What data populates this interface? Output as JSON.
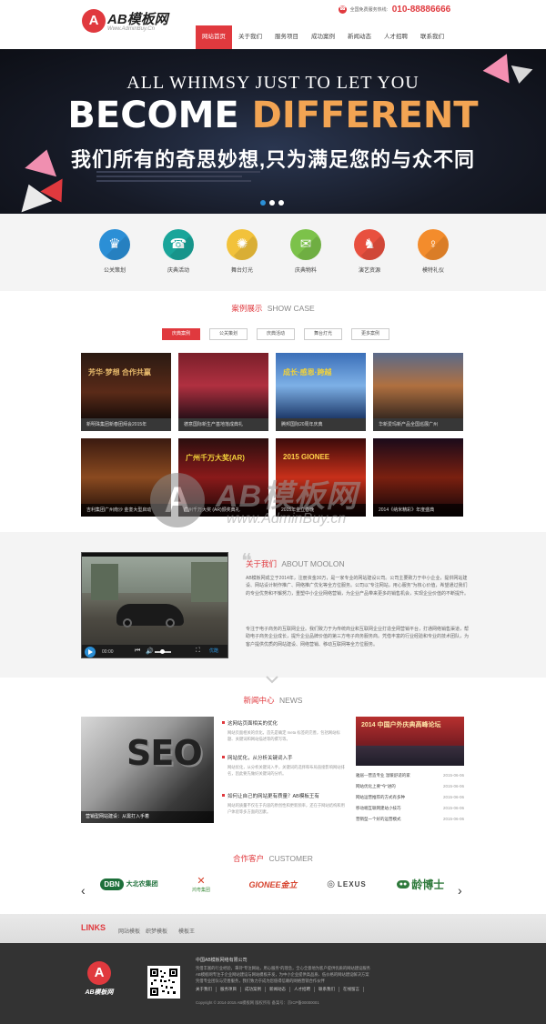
{
  "header": {
    "logo_mark": "A",
    "logo_text": "AB模板网",
    "logo_sub": "Www.AdminBuy.Cn",
    "hotline_label": "全国免费服务热线:",
    "hotline_number": "010-88886666"
  },
  "nav": {
    "items": [
      {
        "label": "网站首页",
        "active": true
      },
      {
        "label": "关于我们"
      },
      {
        "label": "服务项目"
      },
      {
        "label": "成功案例"
      },
      {
        "label": "新闻动态"
      },
      {
        "label": "人才招聘"
      },
      {
        "label": "联系我们"
      }
    ]
  },
  "banner": {
    "line1": "ALL WHIMSY JUST TO LET YOU",
    "big_word1": "BECOME",
    "big_word2": "DIFFERENT",
    "cn": "我们所有的奇思妙想,只为满足您的与众不同",
    "slides": 3,
    "active_slide": 1
  },
  "services": [
    {
      "label": "公关策划",
      "color": "#2b8fd6",
      "icon": "crown-icon",
      "glyph": "♛"
    },
    {
      "label": "庆典活动",
      "color": "#1aa59a",
      "icon": "phone-icon",
      "glyph": "☎"
    },
    {
      "label": "舞台灯光",
      "color": "#f2c23b",
      "icon": "stage-light-icon",
      "glyph": "✺"
    },
    {
      "label": "庆典物料",
      "color": "#7cc24a",
      "icon": "chat-icon",
      "glyph": "✉"
    },
    {
      "label": "演艺资源",
      "color": "#e8503f",
      "icon": "performers-icon",
      "glyph": "♞"
    },
    {
      "label": "模特礼仪",
      "color": "#f38c2c",
      "icon": "model-icon",
      "glyph": "♀"
    }
  ],
  "cases": {
    "title_cn": "案例展示",
    "title_en": "SHOW CASE",
    "tabs": [
      {
        "label": "庆典案例",
        "active": true
      },
      {
        "label": "公关策划"
      },
      {
        "label": "庆典活动"
      },
      {
        "label": "舞台灯光"
      },
      {
        "label": "更多案例"
      }
    ],
    "items": [
      {
        "caption": "新明珠集团新春团拜会2015年",
        "img_text": "芳华·梦想 合作共赢"
      },
      {
        "caption": "德意国际新生产基地落成典礼",
        "img_text": ""
      },
      {
        "caption": "腾邦国际20周年庆典",
        "img_text": "成长·感恩·跨越"
      },
      {
        "caption": "华新爱玛新产品全国巡展广州",
        "img_text": ""
      },
      {
        "caption": "吉利集团广州南沙 金銮大型启动",
        "img_text": ""
      },
      {
        "caption": "广州千万大奖 (AR)颁奖典礼",
        "img_text": "广州千万大奖(AR)"
      },
      {
        "caption": "2015年金立春晚",
        "img_text": "2015 GIONEE"
      },
      {
        "caption": "2014《纳米精彩》年度盛典",
        "img_text": ""
      }
    ]
  },
  "watermark": {
    "mark": "A",
    "text": "AB模板网",
    "url": "www.AdminBuy.cn"
  },
  "about": {
    "title_cn": "关于我们",
    "title_en": "ABOUT MOOLON",
    "p1": "AB模板网成立于2014年，注册资金30万，是一家专业的网站建设公司。公司主要致力于中小企业，提供网站建设、网站设计制作推广、网络推广优化等全方位服务。公司以\"专注网站，用心服务\"为核心价值，希望通过我们的专业优势和不懈努力，重塑中小企业网络营销，为企业产品带来更多的销售机会，实现企业价值的不断提升。",
    "p2": "专注于电子商务的互联网企业。我们致力于为传统商业和互联网企业打造全网营销平台，打通网络销售渠道，帮助电子商务企业成长，提升企业品牌价值的第三方电子商务服务商。凭借丰富的行业经验和专业的技术团队，为客户提供优质的网站建设、网络营销、移动互联网等全方位服务。",
    "video_time": "00:00",
    "video_brand": "优酷"
  },
  "news": {
    "title_cn": "新闻中心",
    "title_en": "NEWS",
    "big_caption": "营销型网站建设：从需打入手着",
    "seo_text": "SEO",
    "list": [
      {
        "title": "这网站页面相关的优化",
        "desc": "网站页面相关的优化，首先是确定 meta 标签的完善，包括网站标题、关键词和网站描述等的撰写等。"
      },
      {
        "title": "网站优化，从分析关键词入手",
        "desc": "网站优化，从分析关键词入手，关键词的选择和布局直接影响网站排名，因此要先做好关键词的分析。"
      },
      {
        "title": "如何让自己的网站更有质量？AB模板王有",
        "desc": "网站的质量不仅在于内容的原创性和更新频率，还在于网站结构和用户体验等多方面的因素。"
      }
    ],
    "right_img_text": "2014 中国户外庆典高峰论坛",
    "right_list": [
      {
        "title": "雅居—营造专业 温暖舒适的家",
        "date": "2015-06-06"
      },
      {
        "title": "网站优化上要\"今\"进的",
        "date": "2015-06-06"
      },
      {
        "title": "网站运营推荐的方式有多种",
        "date": "2015-06-06"
      },
      {
        "title": "移动端互联网建站小技巧",
        "date": "2015-06-06"
      },
      {
        "title": "营销型一个好的运营模式",
        "date": "2015-06-06"
      }
    ]
  },
  "partners": {
    "title_cn": "合作客户",
    "title_en": "CUSTOMER",
    "prev": "‹",
    "next": "›",
    "items": [
      {
        "name": "大北农集团",
        "logo": "DBN"
      },
      {
        "name": "鸿粤集团",
        "logo": "✕"
      },
      {
        "name": "GIONEE金立",
        "logo": ""
      },
      {
        "name": "LEXUS",
        "logo": "◎"
      },
      {
        "name": "龄博士",
        "logo": "龄博士"
      }
    ]
  },
  "links": {
    "label": "LINKS",
    "items": [
      "网站模板",
      "织梦模板",
      "模板王"
    ]
  },
  "footer": {
    "logo_mark": "A",
    "logo_text": "AB模板网",
    "company": "中国AB模板网络有限公司",
    "lines": [
      "凭借丰富的行业经验，秉持“专注网站，用心服务”的理念，全心全意地为客户提供优质的网站建设服务",
      "AB模板网专注于企业网站建设与网站模板开发，为中小企业提供高品质、低价格的网站建设解决方案",
      "凭借专业团队与完善服务，我们致力于成为您值得信赖的网络营销合作伙伴"
    ],
    "nav": [
      "关于我们",
      "服务项目",
      "成功案例",
      "新闻动态",
      "人才招聘",
      "联系我们",
      "在线留言"
    ],
    "copyright": "Copyright © 2014-2015 AB模板网 版权所有 备案号：京ICP备00000001"
  }
}
